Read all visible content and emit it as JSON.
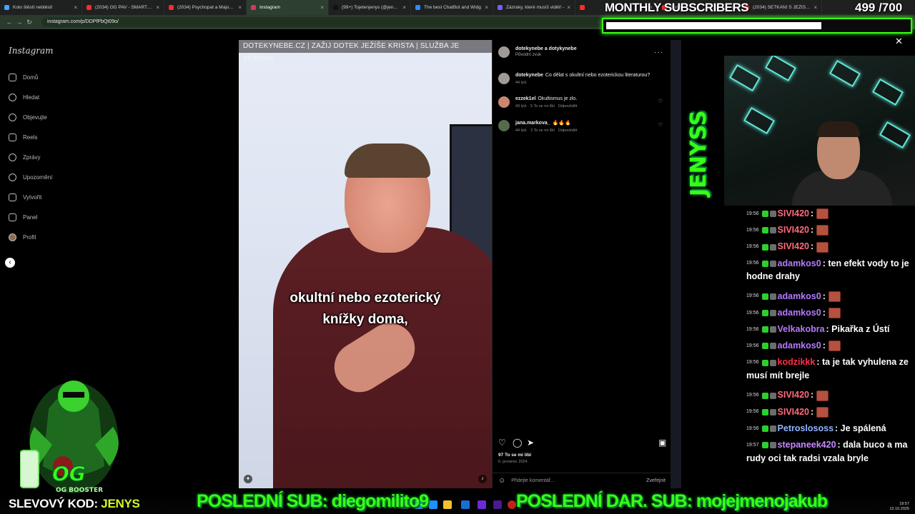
{
  "browser": {
    "tabs": [
      {
        "label": "Kolo štěstí nebtěstí",
        "color": "#4aa3ff",
        "active": false
      },
      {
        "label": "(2034) OG PAV - SMARTFELL!",
        "color": "#ff2a2a",
        "active": false
      },
      {
        "label": "(2034) Psychopat a Majoner",
        "color": "#ff2a2a",
        "active": false
      },
      {
        "label": "Instagram",
        "color": "#e1306c",
        "active": true
      },
      {
        "label": "(99+) Tojetenjenys (@jenysm",
        "color": "#111111",
        "active": false
      },
      {
        "label": "The best ChatBot and Widg",
        "color": "#2e8bff",
        "active": false
      },
      {
        "label": "Zázraky, které musíš vidět! -",
        "color": "#7a5cff",
        "active": false
      },
      {
        "label": "",
        "color": "#ff2a2a",
        "active": false
      },
      {
        "label": "olesti b",
        "color": "#ff2a2a",
        "active": false
      },
      {
        "label": "(2034) SETKÁNÍ S JEŽÍŠEM pr",
        "color": "#ff2a2a",
        "active": false
      }
    ],
    "url": "instagram.com/p/DDPfPbQt09o/"
  },
  "instagram": {
    "logo": "Instagram",
    "nav": [
      "Domů",
      "Hledat",
      "Objevujte",
      "Reels",
      "Zprávy",
      "Upozornění",
      "Vytvořit",
      "Panel",
      "Profil"
    ],
    "video": {
      "banner": "DOTEKYNEBE.CZ | ZAŽIJ DOTEK JEŽÍŠE KRISTA | SLUŽBA JE ZDARMA",
      "subtitle_line1": "okultní nebo ezoterický",
      "subtitle_line2": "knížky doma,"
    },
    "post": {
      "author": "dotekynebe a dotykynebe",
      "audio": "Původní zvuk",
      "caption_user": "dotekynebe",
      "caption_text": "Co dělat s okultní nebo ezoterickou literaturou?",
      "caption_time": "44 týd.",
      "comments": [
        {
          "user": "ezzek1el",
          "text": "Okultismus je zlo.",
          "time": "43 týd.",
          "likes": "5 To se mi líbí",
          "reply": "Odpovědět"
        },
        {
          "user": "jana.markova_",
          "text": "🔥🔥🔥",
          "time": "44 týd.",
          "likes": "2 To se mi líbí",
          "reply": "Odpovědět"
        }
      ],
      "likes": "97 To se mi líbí",
      "date": "6. prosinec 2024",
      "add_comment_placeholder": "Přidejte komentář...",
      "publish": "Zveřejnit"
    }
  },
  "stream": {
    "subs_title": "MONTHLY SUBSCRIBERS",
    "subs_count": "499 /700",
    "subs_progress": 0.713,
    "webcam_brand": "JENYSS",
    "chat": [
      {
        "time": "19:56",
        "user": "SIVI420",
        "color": "#ff6b7d",
        "text": ":",
        "emote": true
      },
      {
        "time": "19:56",
        "user": "SIVI420",
        "color": "#ff6b7d",
        "text": ":",
        "emote": true
      },
      {
        "time": "19:56",
        "user": "SIVI420",
        "color": "#ff6b7d",
        "text": ":",
        "emote": true
      },
      {
        "time": "19:56",
        "user": "adamkos0",
        "color": "#b47bff",
        "text": ": ten efekt vody to je hodne drahy",
        "emote": false
      },
      {
        "time": "19:56",
        "user": "adamkos0",
        "color": "#b47bff",
        "text": ":",
        "emote": true
      },
      {
        "time": "19:56",
        "user": "adamkos0",
        "color": "#b47bff",
        "text": ":",
        "emote": true
      },
      {
        "time": "19:56",
        "user": "Velkakobra",
        "color": "#b47bff",
        "text": ": Pikařka z Ústí",
        "emote": false
      },
      {
        "time": "19:56",
        "user": "adamkos0",
        "color": "#b47bff",
        "text": ":",
        "emote": true
      },
      {
        "time": "19:56",
        "user": "kodzikkk",
        "color": "#ff2e4d",
        "text": ": ta je tak vyhulena ze musí mít brejle",
        "emote": false
      },
      {
        "time": "19:56",
        "user": "SIVI420",
        "color": "#ff6b7d",
        "text": ":",
        "emote": true
      },
      {
        "time": "19:56",
        "user": "SIVI420",
        "color": "#ff6b7d",
        "text": ":",
        "emote": true
      },
      {
        "time": "19:56",
        "user": "Petroslososs",
        "color": "#8fb4ff",
        "text": ": Je spálená",
        "emote": false
      },
      {
        "time": "19:57",
        "user": "stepaneek420",
        "color": "#c68bff",
        "text": ": dala buco a ma rudy oci tak radsi vzala bryle",
        "emote": false
      }
    ],
    "promo_prefix": "SLEVOVÝ KOD: ",
    "promo_code": "JENYS",
    "last_sub": "POSLEDNÍ SUB: diegomilito9",
    "last_gift_sub": "POSLEDNÍ DAR. SUB: mojejmenojakub",
    "booster_label": "OG BOOSTER"
  },
  "taskbar": {
    "time": "19:57",
    "date": "12.10.2025"
  }
}
